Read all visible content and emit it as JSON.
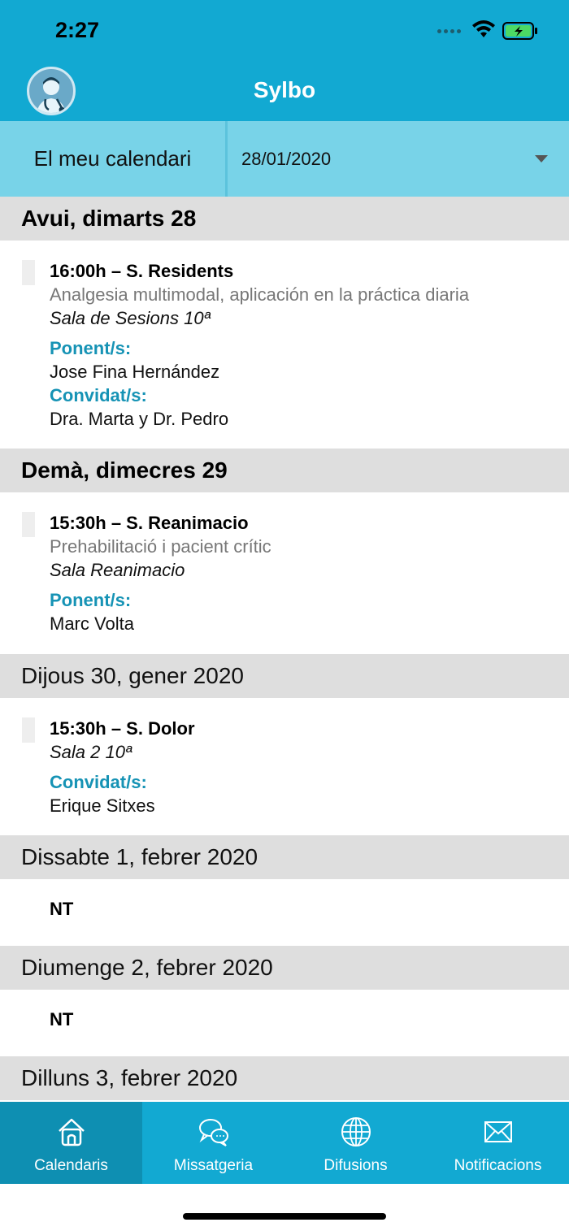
{
  "status_bar": {
    "time": "2:27"
  },
  "header": {
    "title": "Sylbo"
  },
  "selector": {
    "calendar_label": "El meu calendari",
    "date_value": "28/01/2020"
  },
  "days": [
    {
      "header": "Avui, dimarts 28",
      "events": [
        {
          "title": "16:00h  – S. Residents",
          "description": "Analgesia multimodal, aplicación en la práctica diaria",
          "room": "Sala de Sesions 10ª",
          "speakers_label": "Ponent/s:",
          "speakers": "Jose Fina Hernández",
          "guests_label": "Convidat/s:",
          "guests": "Dra. Marta y Dr. Pedro"
        }
      ]
    },
    {
      "header": "Demà, dimecres 29",
      "events": [
        {
          "title": "15:30h  – S. Reanimacio",
          "description": "Prehabilitació i pacient crític",
          "room": "Sala Reanimacio",
          "speakers_label": "Ponent/s:",
          "speakers": "Marc Volta"
        }
      ]
    },
    {
      "header": "Dijous 30, gener 2020",
      "events": [
        {
          "title": "15:30h  – S. Dolor",
          "room": "Sala 2 10ª",
          "guests_label": "Convidat/s:",
          "guests": "Erique Sitxes"
        }
      ]
    },
    {
      "header": "Dissabte 1, febrer 2020",
      "note": "NT"
    },
    {
      "header": "Diumenge 2, febrer 2020",
      "note": "NT"
    },
    {
      "header": "Dilluns 3, febrer 2020"
    }
  ],
  "tabbar": {
    "tabs": [
      {
        "label": "Calendaris",
        "icon": "home-icon",
        "active": true
      },
      {
        "label": "Missatgeria",
        "icon": "chat-bubbles-icon"
      },
      {
        "label": "Difusions",
        "icon": "globe-icon"
      },
      {
        "label": "Notificacions",
        "icon": "envelope-icon"
      }
    ]
  },
  "colors": {
    "primary": "#12a9d2",
    "selector_bg": "#78d3e8",
    "active_tab": "#0e8fb2",
    "label_blue": "#1693b5",
    "day_header_bg": "#dedede"
  }
}
